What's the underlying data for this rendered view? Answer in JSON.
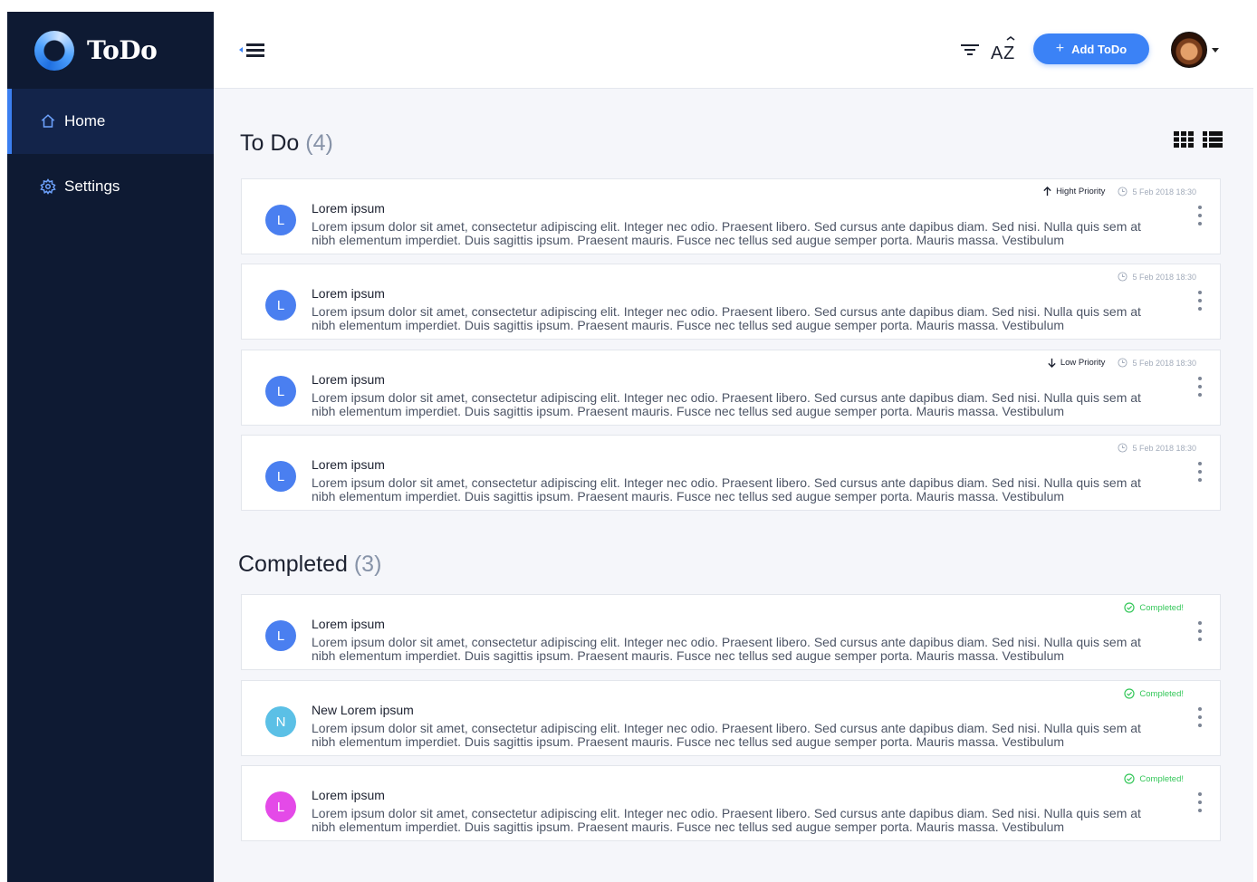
{
  "app": {
    "name": "ToDo"
  },
  "sidebar": {
    "items": [
      {
        "label": "Home",
        "icon": "home-icon",
        "active": true
      },
      {
        "label": "Settings",
        "icon": "gear-icon",
        "active": false
      }
    ]
  },
  "header": {
    "add_label": "Add ToDo",
    "add_icon": "+",
    "icons": [
      "menu-collapse-icon",
      "filter-icon",
      "sort-az-icon",
      "avatar",
      "chevron-down-icon"
    ]
  },
  "todo": {
    "title": "To Do",
    "count": "(4)",
    "items": [
      {
        "initial": "L",
        "color": "#4a7ff0",
        "title": "Lorem ipsum",
        "priority": "Hight Priority",
        "priority_dir": "up",
        "date": "5 Feb 2018 18:30",
        "desc": "Lorem ipsum dolor sit amet, consectetur adipiscing elit. Integer nec odio. Praesent libero. Sed cursus ante dapibus diam. Sed nisi. Nulla quis sem at nibh elementum imperdiet. Duis sagittis ipsum. Praesent mauris. Fusce nec tellus sed augue semper porta. Mauris massa. Vestibulum"
      },
      {
        "initial": "L",
        "color": "#4a7ff0",
        "title": "Lorem ipsum",
        "priority": "",
        "date": "5 Feb 2018 18:30",
        "desc": "Lorem ipsum dolor sit amet, consectetur adipiscing elit. Integer nec odio. Praesent libero. Sed cursus ante dapibus diam. Sed nisi. Nulla quis sem at nibh elementum imperdiet. Duis sagittis ipsum. Praesent mauris. Fusce nec tellus sed augue semper porta. Mauris massa. Vestibulum"
      },
      {
        "initial": "L",
        "color": "#4a7ff0",
        "title": "Lorem ipsum",
        "priority": "Low Priority",
        "priority_dir": "down",
        "date": "5 Feb 2018 18:30",
        "desc": "Lorem ipsum dolor sit amet, consectetur adipiscing elit. Integer nec odio. Praesent libero. Sed cursus ante dapibus diam. Sed nisi. Nulla quis sem at nibh elementum imperdiet. Duis sagittis ipsum. Praesent mauris. Fusce nec tellus sed augue semper porta. Mauris massa. Vestibulum"
      },
      {
        "initial": "L",
        "color": "#4a7ff0",
        "title": "Lorem ipsum",
        "priority": "",
        "date": "5 Feb 2018 18:30",
        "desc": "Lorem ipsum dolor sit amet, consectetur adipiscing elit. Integer nec odio. Praesent libero. Sed cursus ante dapibus diam. Sed nisi. Nulla quis sem at nibh elementum imperdiet. Duis sagittis ipsum. Praesent mauris. Fusce nec tellus sed augue semper porta. Mauris massa. Vestibulum"
      }
    ]
  },
  "completed": {
    "title": "Completed",
    "count": "(3)",
    "items": [
      {
        "initial": "L",
        "color": "#4a7ff0",
        "title": "Lorem ipsum",
        "status": "Completed!",
        "desc": "Lorem ipsum dolor sit amet, consectetur adipiscing elit. Integer nec odio. Praesent libero. Sed cursus ante dapibus diam. Sed nisi. Nulla quis sem at nibh elementum imperdiet. Duis sagittis ipsum. Praesent mauris. Fusce nec tellus sed augue semper porta. Mauris massa. Vestibulum"
      },
      {
        "initial": "N",
        "color": "#5bc0e6",
        "title": "New Lorem ipsum",
        "status": "Completed!",
        "desc": "Lorem ipsum dolor sit amet, consectetur adipiscing elit. Integer nec odio. Praesent libero. Sed cursus ante dapibus diam. Sed nisi. Nulla quis sem at nibh elementum imperdiet. Duis sagittis ipsum. Praesent mauris. Fusce nec tellus sed augue semper porta. Mauris massa. Vestibulum"
      },
      {
        "initial": "L",
        "color": "#e44ae8",
        "title": "Lorem ipsum",
        "status": "Completed!",
        "desc": "Lorem ipsum dolor sit amet, consectetur adipiscing elit. Integer nec odio. Praesent libero. Sed cursus ante dapibus diam. Sed nisi. Nulla quis sem at nibh elementum imperdiet. Duis sagittis ipsum. Praesent mauris. Fusce nec tellus sed augue semper porta. Mauris massa. Vestibulum"
      }
    ]
  },
  "colors": {
    "sidebar": "#0e1a33",
    "accent": "#3b82f6",
    "success": "#35c75a"
  }
}
